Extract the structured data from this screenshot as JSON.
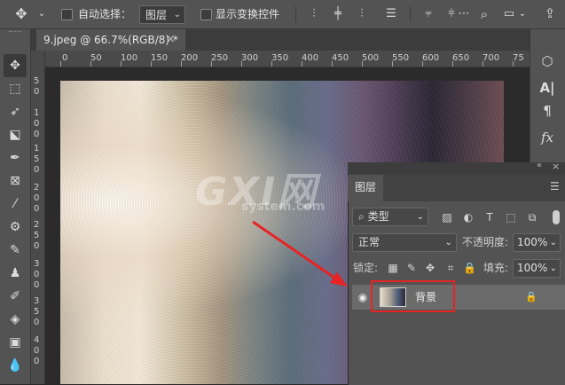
{
  "options_bar": {
    "auto_select_label": "自动选择：",
    "auto_select_value": "图层",
    "show_transform_label": "显示变换控件"
  },
  "document": {
    "tab_title": "9.jpeg @ 66.7%(RGB/8) *",
    "close_glyph": "×"
  },
  "ruler": {
    "h_ticks": [
      "0",
      "50",
      "100",
      "150",
      "200",
      "250",
      "300",
      "350",
      "400",
      "450",
      "500",
      "550",
      "600",
      "650",
      "700",
      "75"
    ],
    "v_ticks": [
      "5",
      "0",
      "1",
      "0",
      "0",
      "1",
      "5",
      "0",
      "2",
      "0",
      "0",
      "2",
      "5",
      "0",
      "3",
      "0",
      "0",
      "3",
      "5",
      "0",
      "4",
      "0",
      "0"
    ]
  },
  "watermark": {
    "main": "GXI网",
    "sub": "system.com"
  },
  "layers_panel": {
    "tab_label": "图层",
    "filter_kind": "类型",
    "blend_mode": "正常",
    "opacity_label": "不透明度:",
    "opacity_value": "100%",
    "lock_label": "锁定:",
    "fill_label": "填充:",
    "fill_value": "100%",
    "layers": [
      {
        "name": "背景",
        "visible": true,
        "locked": true
      }
    ]
  },
  "colors": {
    "highlight_box": "#e82323",
    "panel_bg": "#535353",
    "app_bg": "#282828"
  },
  "icons": {
    "move": "move-tool-icon",
    "eye": "eye-icon",
    "lock": "lock-icon"
  }
}
